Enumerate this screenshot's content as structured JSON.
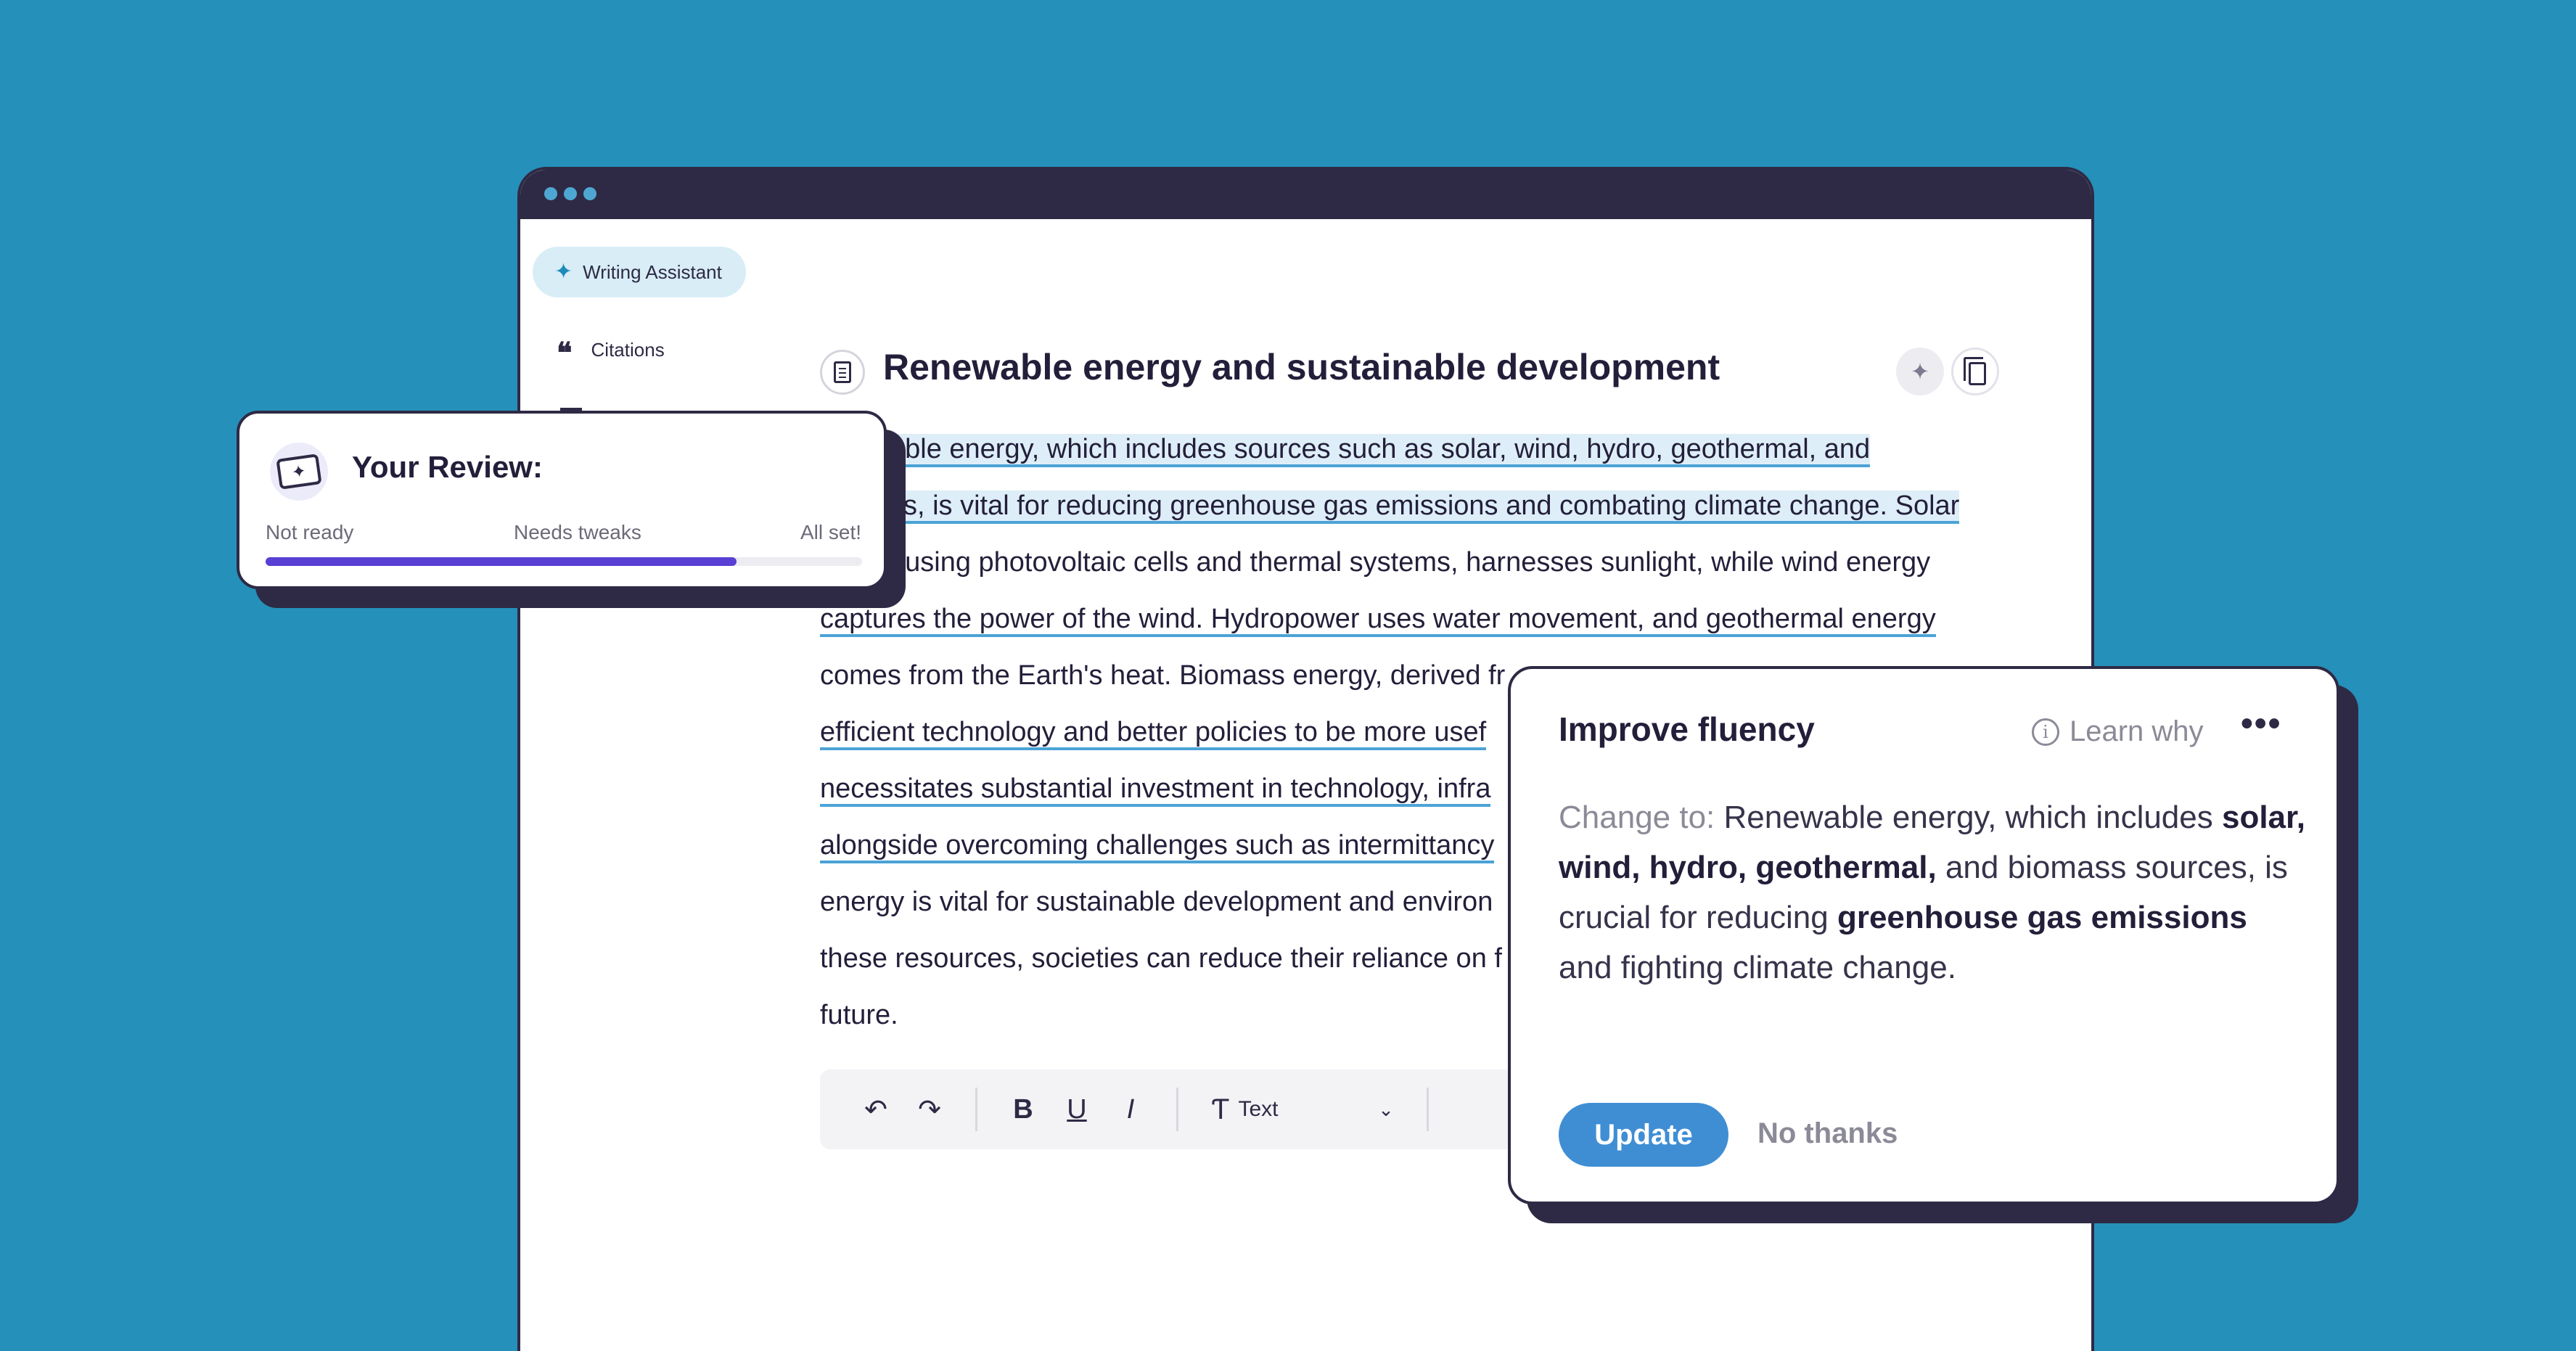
{
  "sidebar": {
    "writing_assistant": "Writing Assistant",
    "citations": "Citations"
  },
  "document": {
    "title": "Renewable energy and sustainable development",
    "lines": [
      "able energy, which includes sources such as solar, wind, hydro, geothermal, and",
      "ss, is vital for reducing greenhouse gas emissions and combating climate change. Solar",
      ", using photovoltaic cells and thermal systems, harnesses sunlight, while wind energy",
      "captures the power of the wind. Hydropower uses water movement, and geothermal energy",
      "comes from the Earth's heat. Biomass energy, derived fr",
      "efficient technology and better policies to be more usef",
      "necessitates substantial investment in technology, infra",
      "alongside overcoming challenges such as intermittancy",
      "energy is vital for sustainable development and environ",
      "these resources, societies can reduce their reliance on f",
      "future."
    ]
  },
  "toolbar": {
    "undo": "↶",
    "redo": "↷",
    "bold": "B",
    "underline": "U",
    "italic": "I",
    "text_style": "Text"
  },
  "review": {
    "title": "Your Review:",
    "labels": [
      "Not ready",
      "Needs tweaks",
      "All set!"
    ],
    "progress": 0.79
  },
  "suggestion": {
    "title": "Improve fluency",
    "learn_why": "Learn why",
    "change_to_label": "Change to:",
    "text_1": " Renewable energy, which includes ",
    "bold_1": "solar, wind, hydro, geothermal,",
    "text_2": " and biomass sources, is crucial for reducing ",
    "bold_2": "greenhouse gas emissions",
    "text_3": " and fighting climate change.",
    "update": "Update",
    "no_thanks": "No thanks"
  },
  "colors": {
    "background": "#2590b9",
    "frame": "#2e2a45",
    "highlight": "#4ba3d6",
    "progress": "#5a3fd4",
    "update_button": "#3f8ed4"
  }
}
